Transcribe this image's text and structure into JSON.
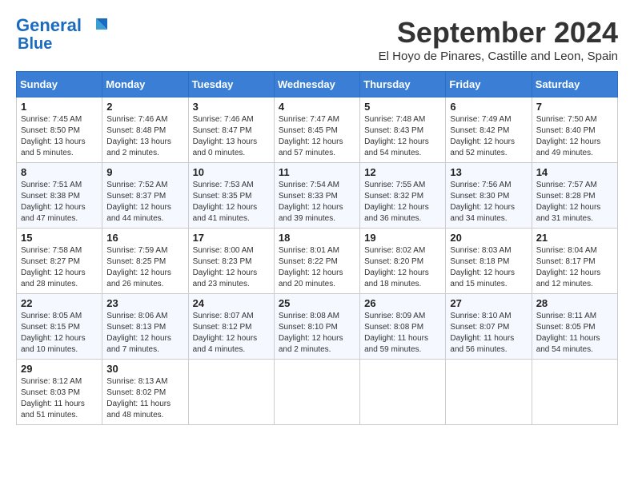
{
  "header": {
    "logo_line1": "General",
    "logo_line2": "Blue",
    "month_title": "September 2024",
    "subtitle": "El Hoyo de Pinares, Castille and Leon, Spain"
  },
  "days_of_week": [
    "Sunday",
    "Monday",
    "Tuesday",
    "Wednesday",
    "Thursday",
    "Friday",
    "Saturday"
  ],
  "weeks": [
    [
      {
        "day": "1",
        "sunrise": "7:45 AM",
        "sunset": "8:50 PM",
        "daylight": "13 hours and 5 minutes."
      },
      {
        "day": "2",
        "sunrise": "7:46 AM",
        "sunset": "8:48 PM",
        "daylight": "13 hours and 2 minutes."
      },
      {
        "day": "3",
        "sunrise": "7:46 AM",
        "sunset": "8:47 PM",
        "daylight": "13 hours and 0 minutes."
      },
      {
        "day": "4",
        "sunrise": "7:47 AM",
        "sunset": "8:45 PM",
        "daylight": "12 hours and 57 minutes."
      },
      {
        "day": "5",
        "sunrise": "7:48 AM",
        "sunset": "8:43 PM",
        "daylight": "12 hours and 54 minutes."
      },
      {
        "day": "6",
        "sunrise": "7:49 AM",
        "sunset": "8:42 PM",
        "daylight": "12 hours and 52 minutes."
      },
      {
        "day": "7",
        "sunrise": "7:50 AM",
        "sunset": "8:40 PM",
        "daylight": "12 hours and 49 minutes."
      }
    ],
    [
      {
        "day": "8",
        "sunrise": "7:51 AM",
        "sunset": "8:38 PM",
        "daylight": "12 hours and 47 minutes."
      },
      {
        "day": "9",
        "sunrise": "7:52 AM",
        "sunset": "8:37 PM",
        "daylight": "12 hours and 44 minutes."
      },
      {
        "day": "10",
        "sunrise": "7:53 AM",
        "sunset": "8:35 PM",
        "daylight": "12 hours and 41 minutes."
      },
      {
        "day": "11",
        "sunrise": "7:54 AM",
        "sunset": "8:33 PM",
        "daylight": "12 hours and 39 minutes."
      },
      {
        "day": "12",
        "sunrise": "7:55 AM",
        "sunset": "8:32 PM",
        "daylight": "12 hours and 36 minutes."
      },
      {
        "day": "13",
        "sunrise": "7:56 AM",
        "sunset": "8:30 PM",
        "daylight": "12 hours and 34 minutes."
      },
      {
        "day": "14",
        "sunrise": "7:57 AM",
        "sunset": "8:28 PM",
        "daylight": "12 hours and 31 minutes."
      }
    ],
    [
      {
        "day": "15",
        "sunrise": "7:58 AM",
        "sunset": "8:27 PM",
        "daylight": "12 hours and 28 minutes."
      },
      {
        "day": "16",
        "sunrise": "7:59 AM",
        "sunset": "8:25 PM",
        "daylight": "12 hours and 26 minutes."
      },
      {
        "day": "17",
        "sunrise": "8:00 AM",
        "sunset": "8:23 PM",
        "daylight": "12 hours and 23 minutes."
      },
      {
        "day": "18",
        "sunrise": "8:01 AM",
        "sunset": "8:22 PM",
        "daylight": "12 hours and 20 minutes."
      },
      {
        "day": "19",
        "sunrise": "8:02 AM",
        "sunset": "8:20 PM",
        "daylight": "12 hours and 18 minutes."
      },
      {
        "day": "20",
        "sunrise": "8:03 AM",
        "sunset": "8:18 PM",
        "daylight": "12 hours and 15 minutes."
      },
      {
        "day": "21",
        "sunrise": "8:04 AM",
        "sunset": "8:17 PM",
        "daylight": "12 hours and 12 minutes."
      }
    ],
    [
      {
        "day": "22",
        "sunrise": "8:05 AM",
        "sunset": "8:15 PM",
        "daylight": "12 hours and 10 minutes."
      },
      {
        "day": "23",
        "sunrise": "8:06 AM",
        "sunset": "8:13 PM",
        "daylight": "12 hours and 7 minutes."
      },
      {
        "day": "24",
        "sunrise": "8:07 AM",
        "sunset": "8:12 PM",
        "daylight": "12 hours and 4 minutes."
      },
      {
        "day": "25",
        "sunrise": "8:08 AM",
        "sunset": "8:10 PM",
        "daylight": "12 hours and 2 minutes."
      },
      {
        "day": "26",
        "sunrise": "8:09 AM",
        "sunset": "8:08 PM",
        "daylight": "11 hours and 59 minutes."
      },
      {
        "day": "27",
        "sunrise": "8:10 AM",
        "sunset": "8:07 PM",
        "daylight": "11 hours and 56 minutes."
      },
      {
        "day": "28",
        "sunrise": "8:11 AM",
        "sunset": "8:05 PM",
        "daylight": "11 hours and 54 minutes."
      }
    ],
    [
      {
        "day": "29",
        "sunrise": "8:12 AM",
        "sunset": "8:03 PM",
        "daylight": "11 hours and 51 minutes."
      },
      {
        "day": "30",
        "sunrise": "8:13 AM",
        "sunset": "8:02 PM",
        "daylight": "11 hours and 48 minutes."
      },
      null,
      null,
      null,
      null,
      null
    ]
  ]
}
